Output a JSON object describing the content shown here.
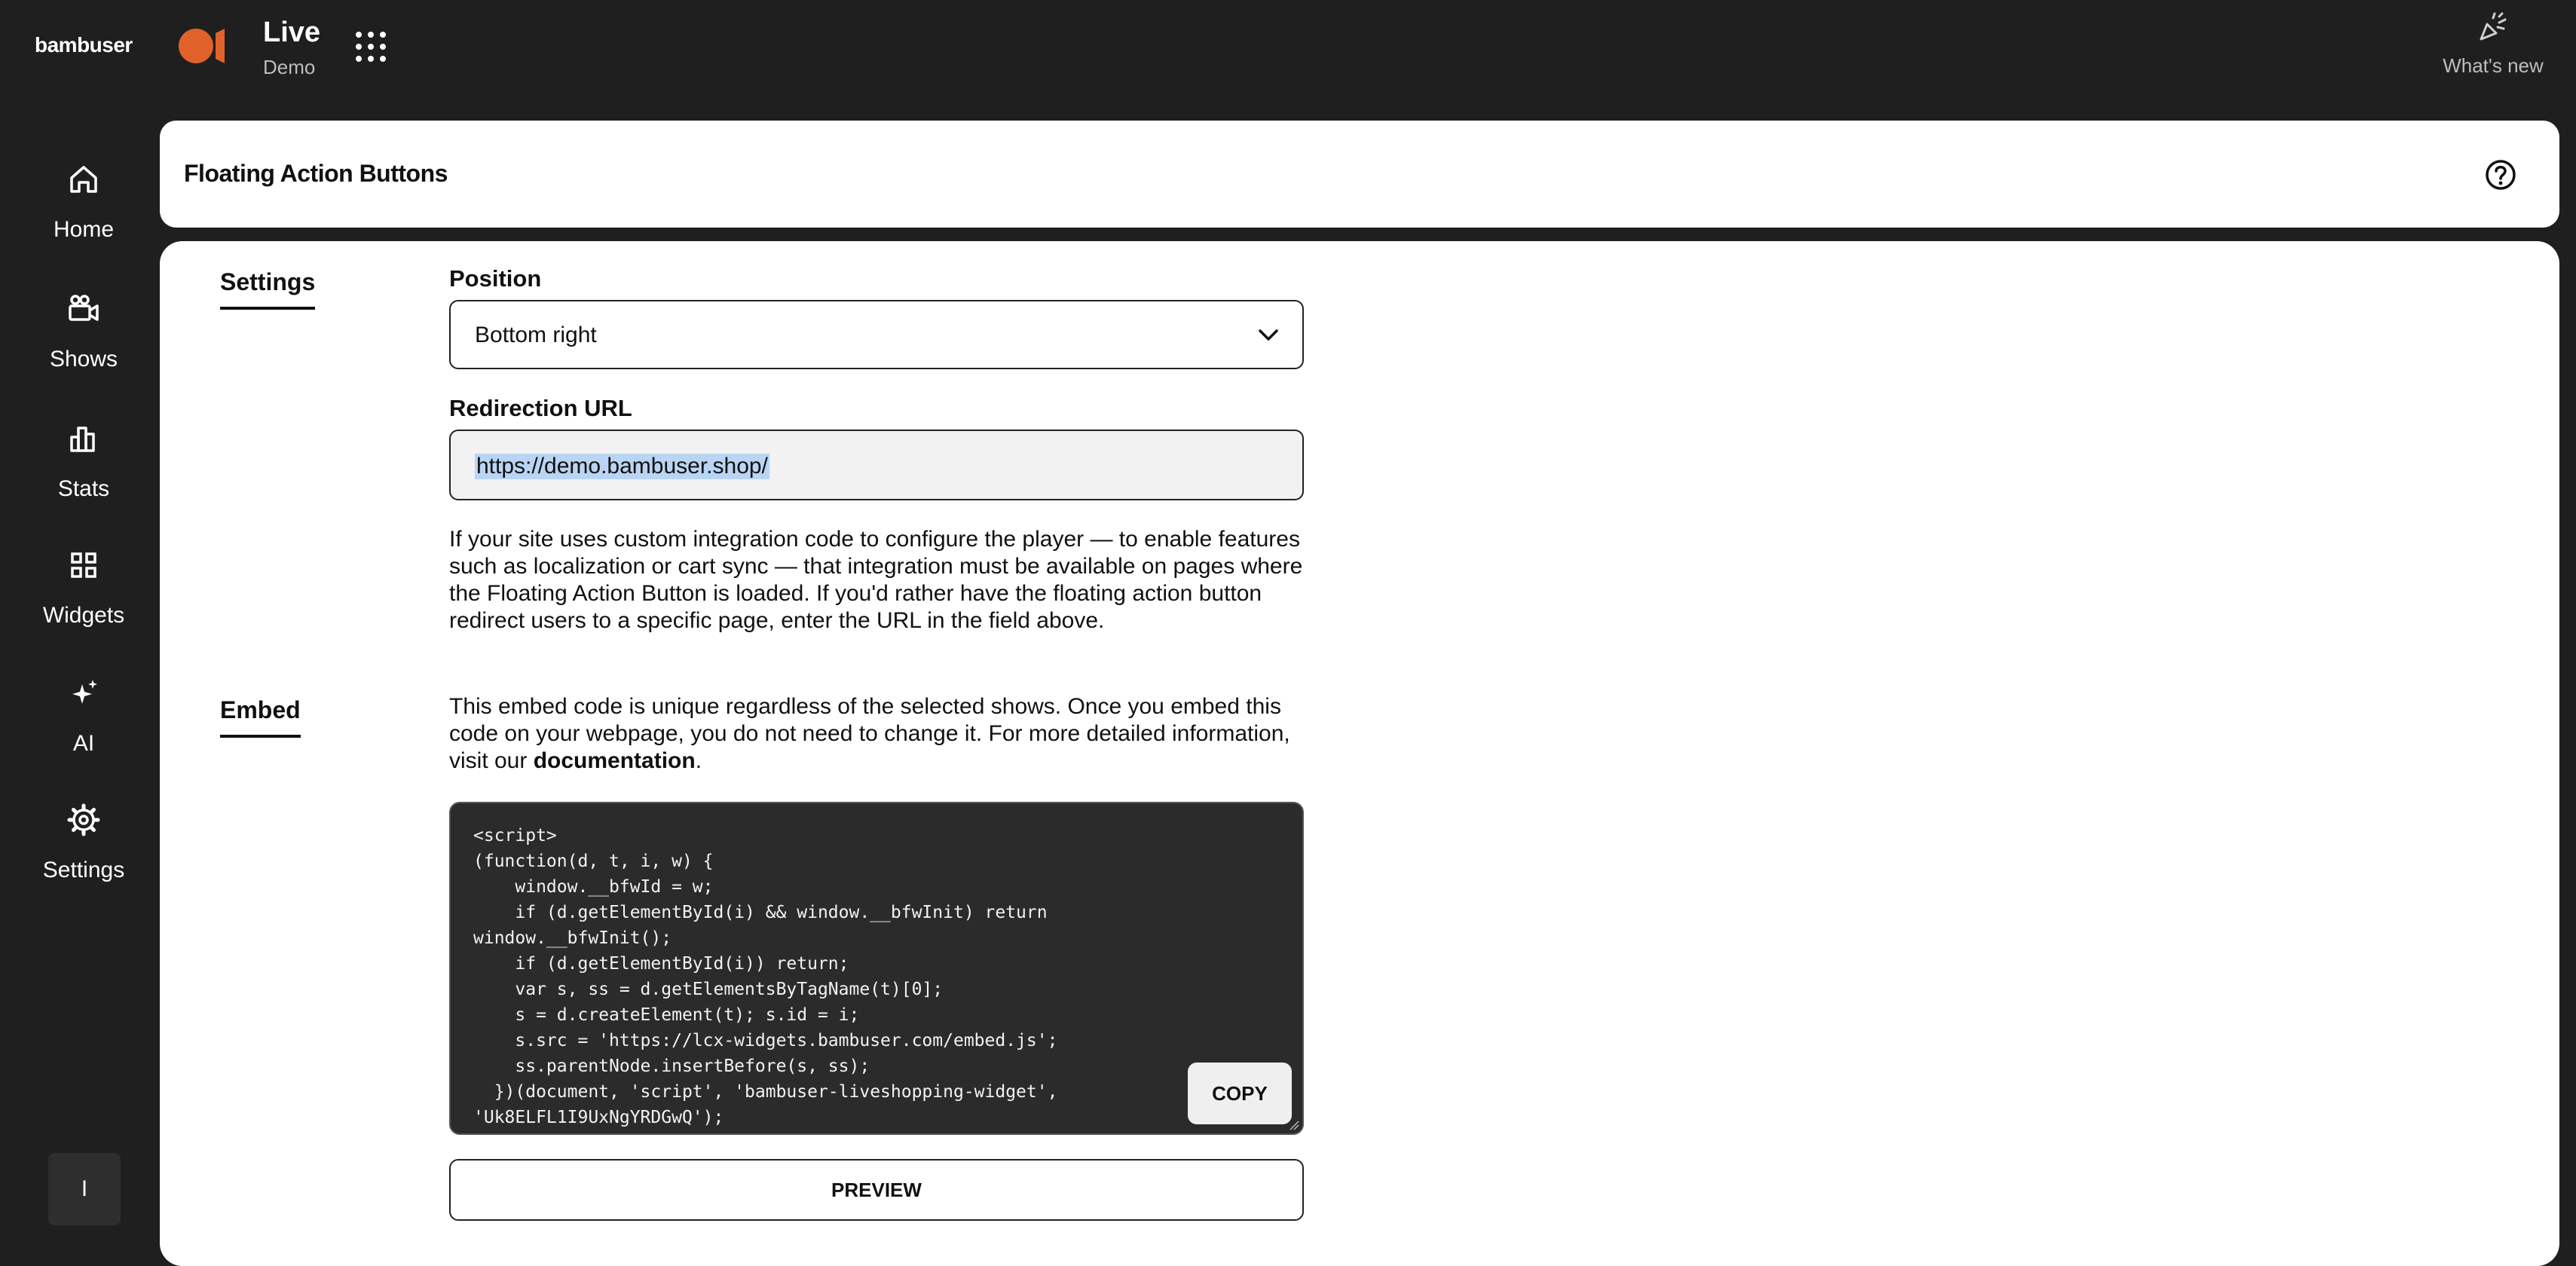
{
  "app": {
    "brand": "bambuser"
  },
  "context": {
    "title": "Live",
    "subtitle": "Demo"
  },
  "whats_new": {
    "label": "What's new"
  },
  "nav": {
    "items": [
      {
        "label": "Home",
        "icon": "home-icon"
      },
      {
        "label": "Shows",
        "icon": "camera-icon"
      },
      {
        "label": "Stats",
        "icon": "bar-chart-icon"
      },
      {
        "label": "Widgets",
        "icon": "grid-icon"
      },
      {
        "label": "AI",
        "icon": "sparkles-icon"
      },
      {
        "label": "Settings",
        "icon": "gear-icon"
      }
    ],
    "user_initial": "I"
  },
  "header": {
    "title": "Floating Action Buttons"
  },
  "settings": {
    "tab_label": "Settings",
    "position_label": "Position",
    "position_value": "Bottom right",
    "redirect_label": "Redirection URL",
    "redirect_value": "https://demo.bambuser.shop/",
    "help_text": "If your site uses custom integration code to configure the player — to enable features such as localization or cart sync — that integration must be available on pages where the Floating Action Button is loaded. If you'd rather have the floating action button redirect users to a specific page, enter the URL in the field above."
  },
  "embed": {
    "tab_label": "Embed",
    "description": "This embed code is unique regardless of the selected shows. Once you embed this code on your webpage, you do not need to change it. For more detailed information, visit our ",
    "doc_link": "documentation",
    "description_end": ".",
    "code": "<script>\n(function(d, t, i, w) {\n    window.__bfwId = w;\n    if (d.getElementById(i) && window.__bfwInit) return\nwindow.__bfwInit();\n    if (d.getElementById(i)) return;\n    var s, ss = d.getElementsByTagName(t)[0];\n    s = d.createElement(t); s.id = i;\n    s.src = 'https://lcx-widgets.bambuser.com/embed.js';\n    ss.parentNode.insertBefore(s, ss);\n  })(document, 'script', 'bambuser-liveshopping-widget',\n'Uk8ELFL1I9UxNgYRDGwQ');",
    "copy_label": "COPY",
    "preview_label": "PREVIEW"
  },
  "colors": {
    "accent": "#e0622a",
    "background": "#1f1f1f",
    "card": "#ffffff",
    "selection": "#b9d5f3"
  }
}
